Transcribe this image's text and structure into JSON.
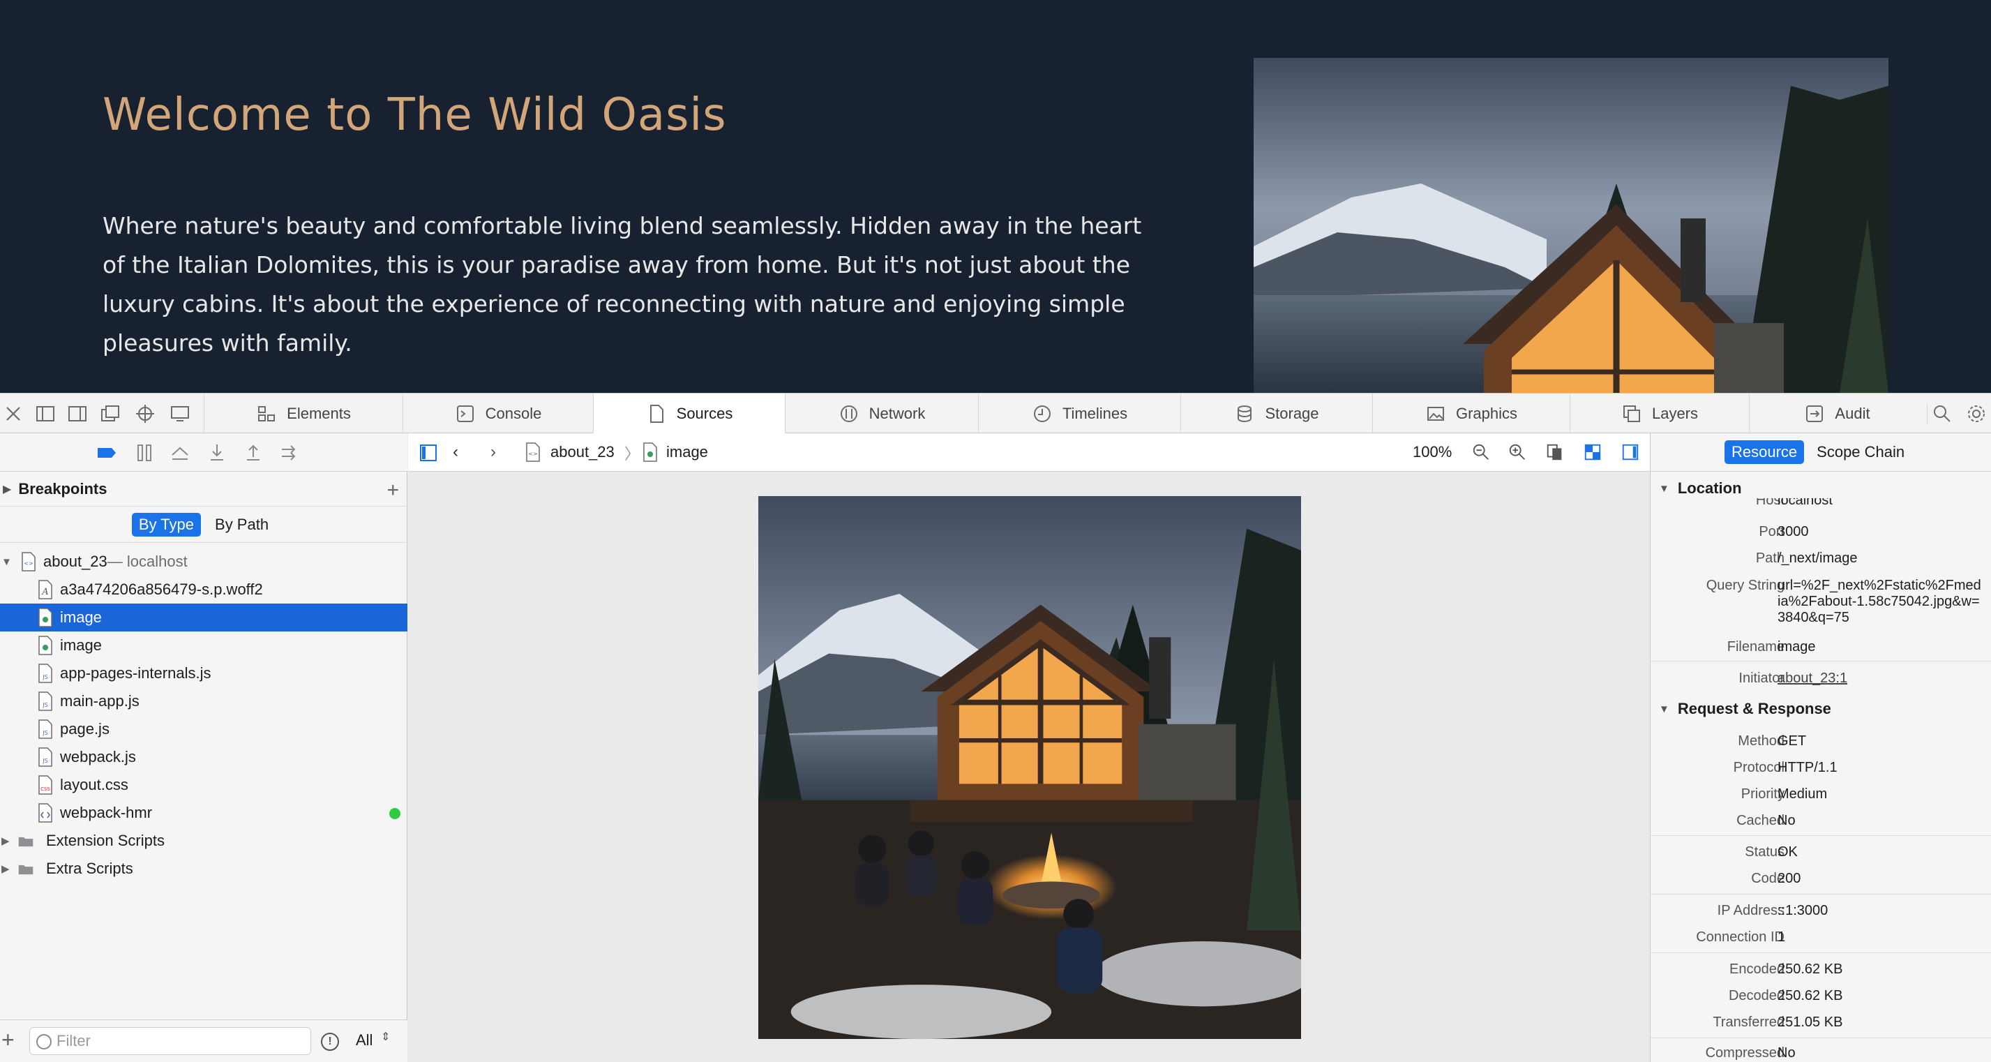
{
  "hero": {
    "title": "Welcome to The Wild Oasis",
    "text": "Where nature's beauty and comfortable living blend seamlessly. Hidden away in the heart of the Italian Dolomites, this is your paradise away from home. But it's not just about the luxury cabins. It's about the experience of reconnecting with nature and enjoying simple pleasures with family."
  },
  "tabs": [
    {
      "label": "Elements",
      "icon": "elements-icon"
    },
    {
      "label": "Console",
      "icon": "console-icon"
    },
    {
      "label": "Sources",
      "icon": "sources-icon",
      "active": true
    },
    {
      "label": "Network",
      "icon": "network-icon"
    },
    {
      "label": "Timelines",
      "icon": "timelines-icon"
    },
    {
      "label": "Storage",
      "icon": "storage-icon"
    },
    {
      "label": "Graphics",
      "icon": "graphics-icon"
    },
    {
      "label": "Layers",
      "icon": "layers-icon"
    },
    {
      "label": "Audit",
      "icon": "audit-icon"
    }
  ],
  "sidebar": {
    "breakpoints_label": "Breakpoints",
    "by_type": "By Type",
    "by_path": "By Path",
    "root": {
      "name": "about_23",
      "host": " — localhost"
    },
    "files": [
      {
        "name": "a3a474206a856479-s.p.woff2",
        "type": "font"
      },
      {
        "name": "image",
        "type": "image",
        "selected": true
      },
      {
        "name": "image",
        "type": "image"
      },
      {
        "name": "app-pages-internals.js",
        "type": "js"
      },
      {
        "name": "main-app.js",
        "type": "js"
      },
      {
        "name": "page.js",
        "type": "js"
      },
      {
        "name": "webpack.js",
        "type": "js"
      },
      {
        "name": "layout.css",
        "type": "css"
      },
      {
        "name": "webpack-hmr",
        "type": "socket",
        "status": "connected"
      }
    ],
    "folders": [
      "Extension Scripts",
      "Extra Scripts"
    ],
    "filter_placeholder": "Filter",
    "filter_scope": "All"
  },
  "center": {
    "crumb_1": "about_23",
    "crumb_2": "image",
    "zoom": "100%"
  },
  "details": {
    "tab_resource": "Resource",
    "tab_scope": "Scope Chain",
    "location_header": "Location",
    "host_k": "Host",
    "host_v": "localhost",
    "port_k": "Port",
    "port_v": "3000",
    "path_k": "Path",
    "path_v": "/_next/image",
    "query_k": "Query String",
    "query_v": "url=%2F_next%2Fstatic%2Fmedia%2Fabout-1.58c75042.jpg&w=3840&q=75",
    "filename_k": "Filename",
    "filename_v": "image",
    "initiator_k": "Initiator",
    "initiator_v": "about_23:1",
    "rr_header": "Request & Response",
    "method_k": "Method",
    "method_v": "GET",
    "protocol_k": "Protocol",
    "protocol_v": "HTTP/1.1",
    "priority_k": "Priority",
    "priority_v": "Medium",
    "cached_k": "Cached",
    "cached_v": "No",
    "status_k": "Status",
    "status_v": "OK",
    "code_k": "Code",
    "code_v": "200",
    "ip_k": "IP Address",
    "ip_v": "::1:3000",
    "conn_k": "Connection ID",
    "conn_v": "1",
    "encoded_k": "Encoded",
    "encoded_v": "250.62 KB",
    "decoded_k": "Decoded",
    "decoded_v": "250.62 KB",
    "transferred_k": "Transferred",
    "transferred_v": "251.05 KB",
    "compressed_k": "Compressed",
    "compressed_v": "No"
  }
}
